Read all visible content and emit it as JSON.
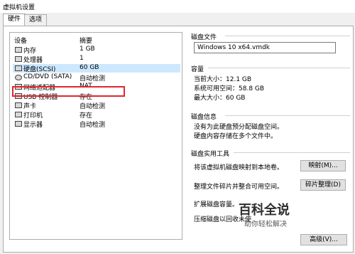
{
  "window": {
    "title": "虚拟机设置"
  },
  "tabs": [
    {
      "label": "硬件"
    },
    {
      "label": "选项"
    }
  ],
  "devices": {
    "headers": {
      "device": "设备",
      "summary": "摘要"
    },
    "items": [
      {
        "name": "内存",
        "summary": "1 GB",
        "icon": "memory-icon"
      },
      {
        "name": "处理器",
        "summary": "1",
        "icon": "cpu-icon"
      },
      {
        "name": "硬盘(SCSI)",
        "summary": "60 GB",
        "icon": "hard-disk-icon",
        "selected": true
      },
      {
        "name": "CD/DVD (SATA)",
        "summary": "自动检测",
        "icon": "cd-dvd-icon"
      },
      {
        "name": "网络适配器",
        "summary": "NAT",
        "icon": "network-adapter-icon"
      },
      {
        "name": "USB 控制器",
        "summary": "存在",
        "icon": "usb-icon"
      },
      {
        "name": "声卡",
        "summary": "自动检测",
        "icon": "sound-card-icon"
      },
      {
        "name": "打印机",
        "summary": "存在",
        "icon": "printer-icon"
      },
      {
        "name": "显示器",
        "summary": "自动检测",
        "icon": "display-icon"
      }
    ]
  },
  "disk_file": {
    "title": "磁盘文件",
    "value": "Windows 10 x64.vmdk"
  },
  "capacity": {
    "title": "容量",
    "current": "当前大小：12.1 GB",
    "free": "系统可用空间：58.8 GB",
    "max": "最大大小：60 GB"
  },
  "disk_info": {
    "title": "磁盘信息",
    "line1": "没有为此硬盘预分配磁盘空间。",
    "line2": "硬盘内容存储在多个文件中。"
  },
  "utilities": {
    "title": "磁盘实用工具",
    "map_text": "将该虚拟机磁盘映射到本地卷。",
    "map_button": "映射(M)...",
    "defrag_text": "整理文件碎片并整合可用空间。",
    "defrag_button": "碎片整理(D)",
    "expand_text": "扩展磁盘容量。",
    "compact_text": "压缩磁盘以回收未使"
  },
  "advanced_button": "高级(V)...",
  "watermark": {
    "brand": "百科全说",
    "tagline": "助你轻松解决"
  }
}
